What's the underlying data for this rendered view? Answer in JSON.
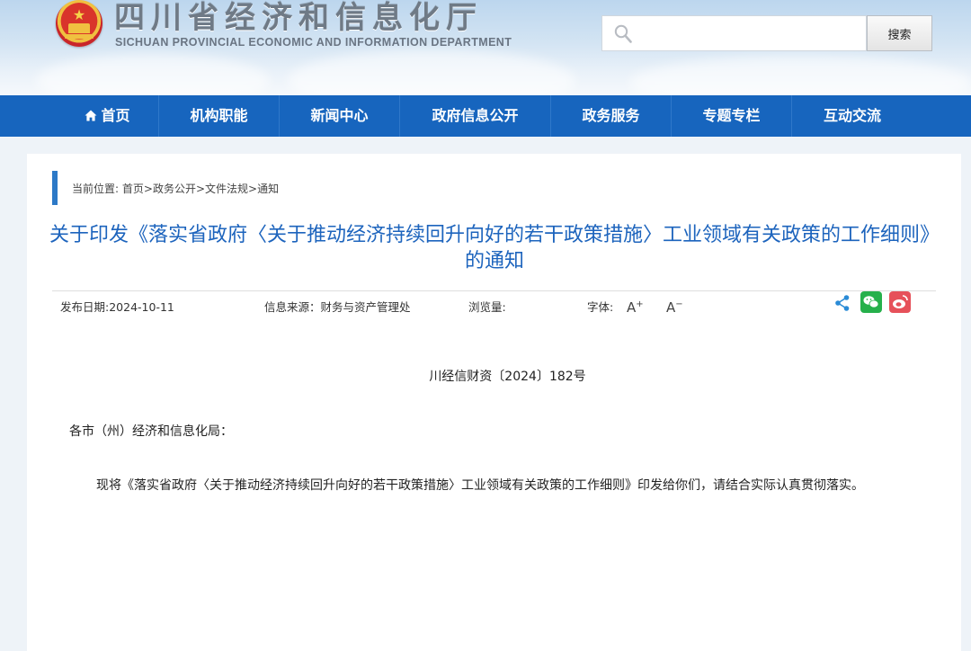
{
  "header": {
    "title_cn": "四川省经济和信息化厅",
    "title_en": "SICHUAN PROVINCIAL ECONOMIC AND INFORMATION DEPARTMENT",
    "search": {
      "placeholder": "",
      "value": "",
      "button_label": "搜索"
    }
  },
  "nav": {
    "items": [
      {
        "label": "首页",
        "icon": "home-icon"
      },
      {
        "label": "机构职能"
      },
      {
        "label": "新闻中心"
      },
      {
        "label": "政府信息公开"
      },
      {
        "label": "政务服务"
      },
      {
        "label": "专题专栏"
      },
      {
        "label": "互动交流"
      }
    ]
  },
  "breadcrumb": {
    "prefix": "当前位置: ",
    "items": [
      "首页",
      "政务公开",
      "文件法规",
      "通知"
    ],
    "separator": ">"
  },
  "article": {
    "title": "关于印发《落实省政府〈关于推动经济持续回升向好的若干政策措施〉工业领域有关政策的工作细则》的通知",
    "meta": {
      "publish_date": "发布日期:2024-10-11",
      "source": "信息来源：财务与资产管理处",
      "views": "浏览量:",
      "font_size_label": "字体:"
    },
    "doc_number": "川经信财资〔2024〕182号",
    "salutation": "各市（州）经济和信息化局：",
    "body": "现将《落实省政府〈关于推动经济持续回升向好的若干政策措施〉工业领域有关政策的工作细则》印发给你们，请结合实际认真贯彻落实。"
  },
  "share": {
    "icons": [
      "share-icon",
      "wechat-icon",
      "weibo-icon"
    ],
    "colors": {
      "share": "#2a8bd6",
      "wechat": "#26b04b",
      "weibo": "#e6515a"
    }
  },
  "colors": {
    "nav_bg": "#1765be",
    "title_blue": "#1d64bd",
    "accent_bar": "#2c79c7"
  }
}
